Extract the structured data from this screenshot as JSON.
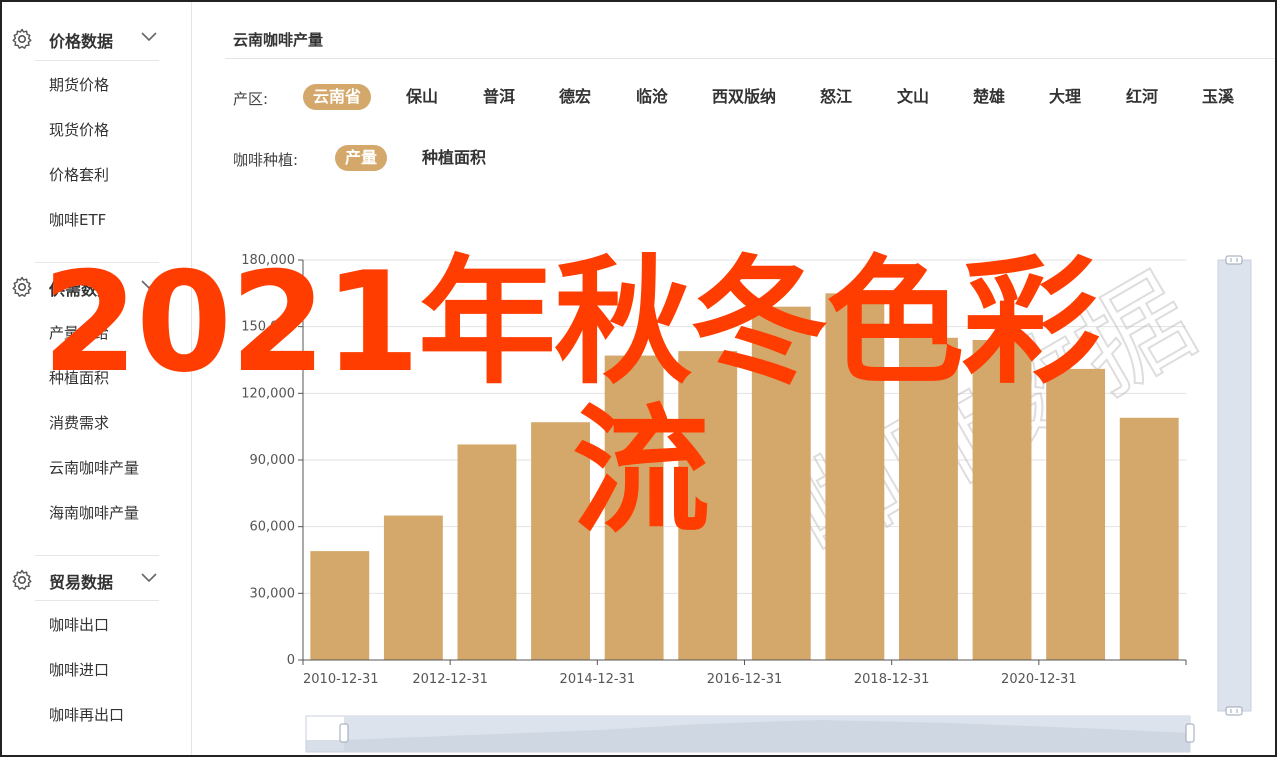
{
  "sidebar": {
    "groups": [
      {
        "title": "价格数据",
        "items": [
          "期货价格",
          "现货价格",
          "价格套利",
          "咖啡ETF"
        ]
      },
      {
        "title": "供需数据",
        "items": [
          "产量供给",
          "种植面积",
          "消费需求",
          "云南咖啡产量",
          "海南咖啡产量"
        ]
      },
      {
        "title": "贸易数据",
        "items": [
          "咖啡出口",
          "咖啡进口",
          "咖啡再出口"
        ]
      }
    ]
  },
  "main": {
    "title": "云南咖啡产量",
    "region_label": "产区:",
    "regions": [
      "云南省",
      "保山",
      "普洱",
      "德宏",
      "临沧",
      "西双版纳",
      "怒江",
      "文山",
      "楚雄",
      "大理",
      "红河",
      "玉溪"
    ],
    "region_active": "云南省",
    "plant_label": "咖啡种植:",
    "plant_options": [
      "产量",
      "种植面积"
    ],
    "plant_active": "产量"
  },
  "overlay": {
    "line1": "2021年秋冬色彩",
    "line2": "流"
  },
  "chart_data": {
    "type": "bar",
    "x": [
      "2010-12-31",
      "2011-12-31",
      "2012-12-31",
      "2013-12-31",
      "2014-12-31",
      "2015-12-31",
      "2016-12-31",
      "2017-12-31",
      "2018-12-31",
      "2019-12-31",
      "2020-12-31",
      "2021-12-31"
    ],
    "values": [
      49000,
      65000,
      97000,
      107000,
      137000,
      139000,
      159000,
      165000,
      145000,
      144000,
      131000,
      109000
    ],
    "x_tick_labels": [
      "2010-12-31",
      "2012-12-31",
      "2014-12-31",
      "2016-12-31",
      "2018-12-31",
      "2020-12-31"
    ],
    "y_tick_labels": [
      "0",
      "30,000",
      "60,000",
      "90,000",
      "120,000",
      "150,000",
      "180,000"
    ],
    "ylim": [
      0,
      180000
    ],
    "grid": true,
    "bar_color": "#d4a76a"
  },
  "colors": {
    "accent": "#d4a76a",
    "overlay": "#ff3d00"
  },
  "icons": {
    "group": "gear-icon",
    "toggle": "chevron-down-icon"
  }
}
